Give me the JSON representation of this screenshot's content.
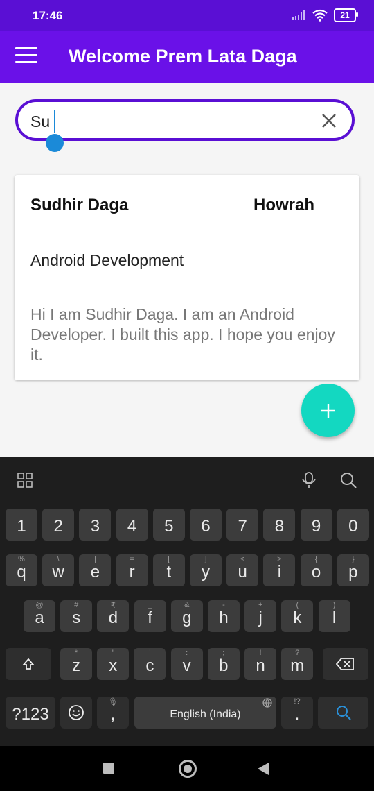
{
  "status": {
    "time": "17:46",
    "battery": "21"
  },
  "app_bar": {
    "title": "Welcome Prem Lata Daga"
  },
  "search": {
    "value": "Su"
  },
  "card": {
    "name": "Sudhir Daga",
    "city": "Howrah",
    "skill": "Android Development",
    "description": "Hi I am Sudhir Daga. I am an Android Developer. I built this app. I hope you enjoy it."
  },
  "fab": {
    "label": "+"
  },
  "keyboard": {
    "numbers": [
      "1",
      "2",
      "3",
      "4",
      "5",
      "6",
      "7",
      "8",
      "9",
      "0"
    ],
    "row1": [
      "q",
      "w",
      "e",
      "r",
      "t",
      "y",
      "u",
      "i",
      "o",
      "p"
    ],
    "row1_hints": [
      "%",
      "\\",
      "|",
      "=",
      "[",
      "]",
      "<",
      ">",
      "{",
      "}"
    ],
    "row2": [
      "a",
      "s",
      "d",
      "f",
      "g",
      "h",
      "j",
      "k",
      "l"
    ],
    "row2_hints": [
      "@",
      "#",
      "₹",
      "_",
      "&",
      "-",
      "+",
      "(",
      ")"
    ],
    "row3": [
      "z",
      "x",
      "c",
      "v",
      "b",
      "n",
      "m"
    ],
    "row3_hints": [
      "*",
      "\"",
      "'",
      ":",
      ";",
      "!",
      "?"
    ],
    "sym_label": "?123",
    "comma": ",",
    "comma_hint": "🎙",
    "space_label": "English (India)",
    "period": ".",
    "period_hint": "!?"
  }
}
